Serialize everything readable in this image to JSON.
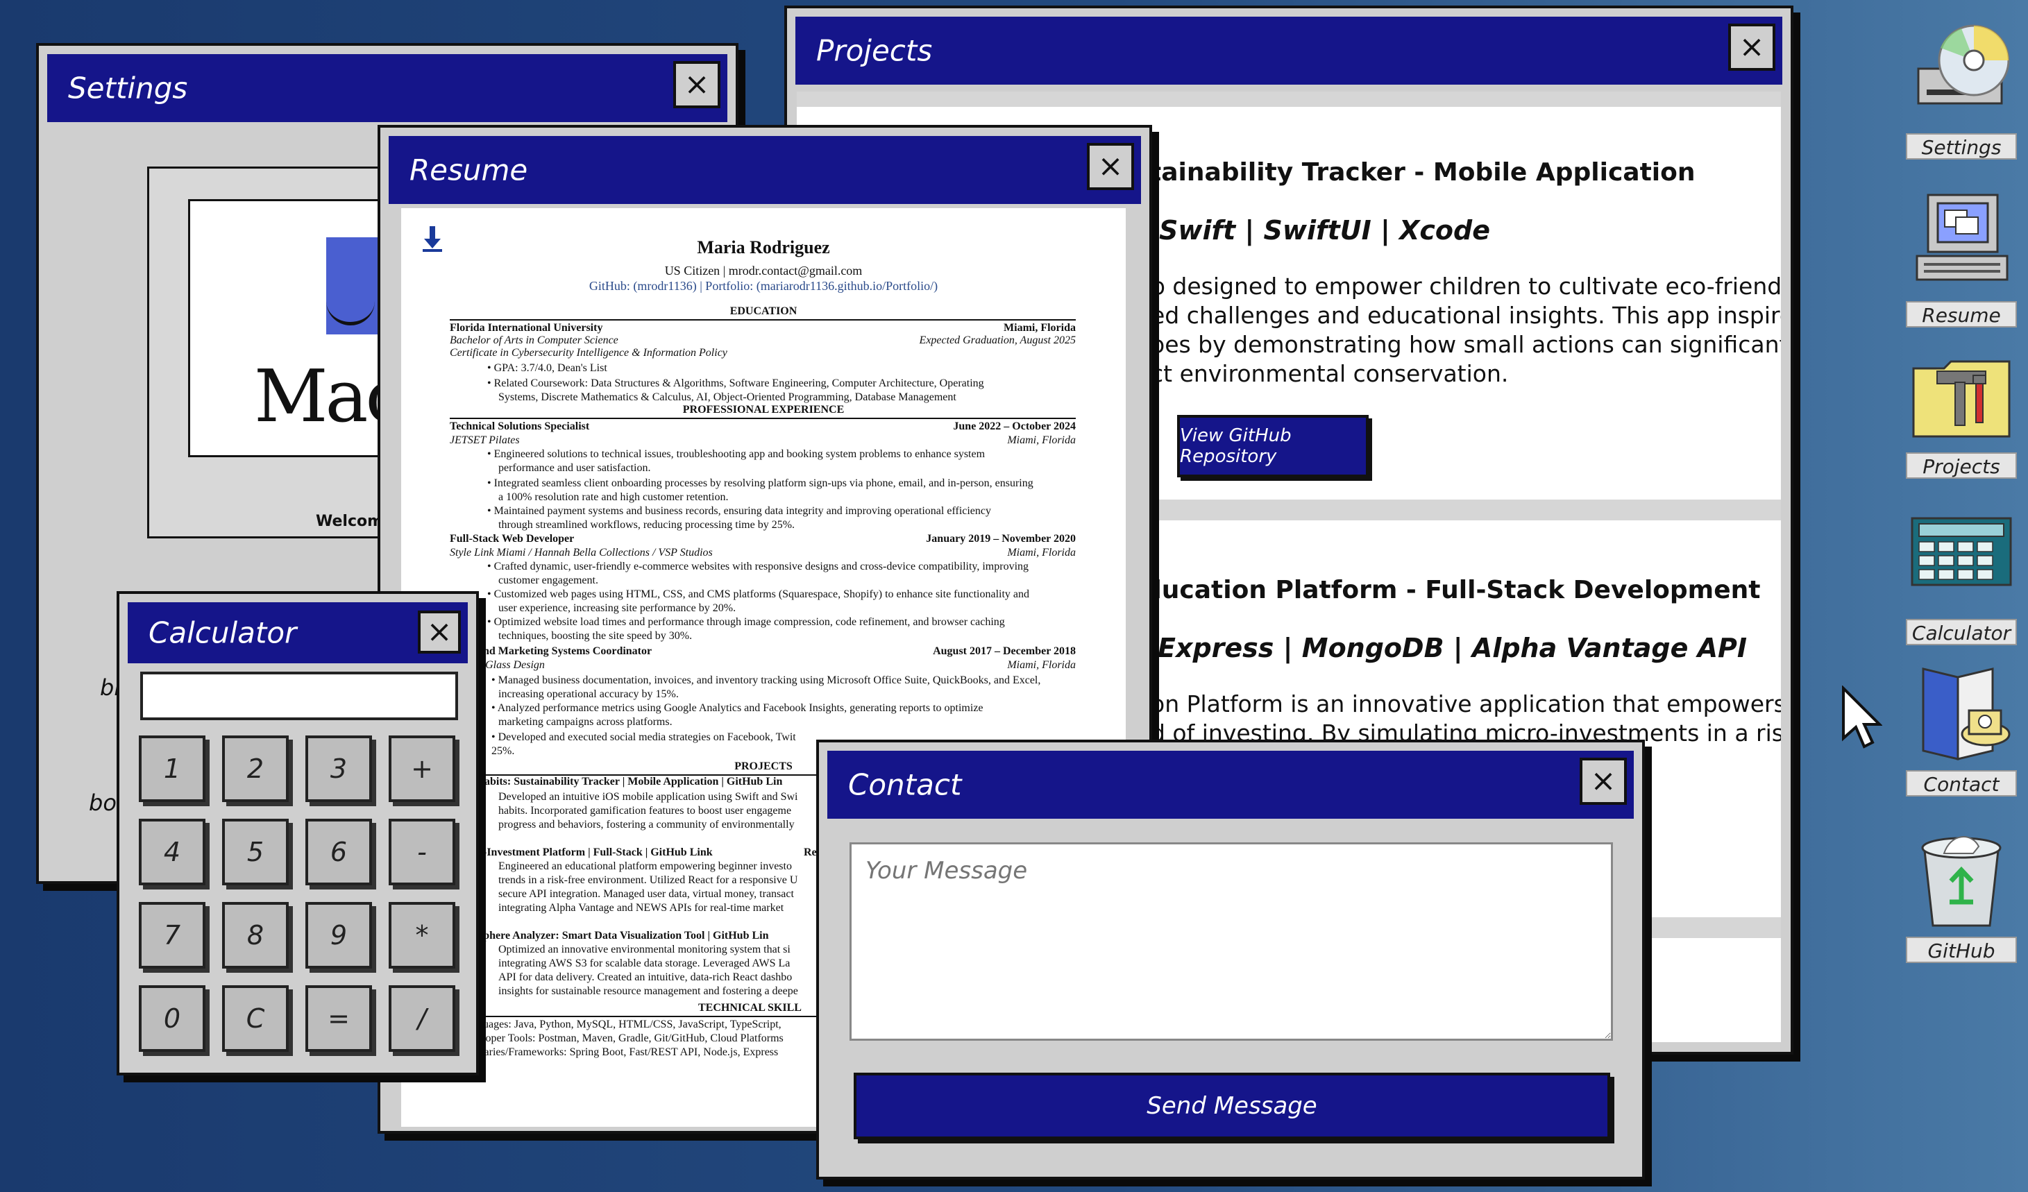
{
  "windows": {
    "settings": {
      "title": "Settings",
      "close": "×",
      "mac_text": "Mac",
      "welcome_text": "Welcom",
      "clipped_text": [
        "bl",
        "bo"
      ]
    },
    "projects": {
      "title": "Projects",
      "close": "×",
      "items": [
        {
          "title": "tainability Tracker - Mobile Application",
          "tech": "Swift | SwiftUI | Xcode",
          "desc": "p designed to empower children to cultivate eco-friendly\ned challenges and educational insights. This app inspires\noes by demonstrating how small actions can significantly\nct environmental conservation.",
          "button": "View GitHub Repository"
        },
        {
          "title": "ducation Platform - Full-Stack Development",
          "tech": "Express | MongoDB | Alpha Vantage API",
          "desc": "on Platform is an innovative application that empowers\nd of investing. By simulating micro-investments in a risk-\ntrategies\nal money."
        }
      ]
    },
    "resume": {
      "title": "Resume",
      "close": "×",
      "name": "Maria Rodriguez",
      "contact_line": "US Citizen | mrodr.contact@gmail.com",
      "links_line": "GitHub: (mrodr1136) | Portfolio: (mariarodr1136.github.io/Portfolio/)",
      "lines": [
        "EDUCATION",
        "Florida International University",
        "Miami, Florida",
        "Bachelor of Arts in Computer Science",
        "Expected Graduation, August 2025",
        "Certificate in Cybersecurity Intelligence & Information Policy",
        "• GPA: 3.7/4.0, Dean's List",
        "• Related Coursework: Data Structures & Algorithms, Software Engineering, Computer Architecture, Operating",
        "Systems, Discrete Mathematics & Calculus, AI, Object-Oriented Programming, Database Management",
        "PROFESSIONAL EXPERIENCE",
        "Technical Solutions Specialist",
        "June 2022 – October 2024",
        "JETSET Pilates",
        "Miami, Florida",
        "• Engineered solutions to technical issues, troubleshooting app and booking system problems to enhance system",
        "performance and user satisfaction.",
        "• Integrated seamless client onboarding processes by resolving platform sign-ups via phone, email, and in-person, ensuring",
        "a 100% resolution rate and high customer retention.",
        "• Maintained payment systems and business records, ensuring data integrity and improving operational efficiency",
        "through streamlined workflows, reducing processing time by 25%.",
        "Full-Stack Web Developer",
        "January 2019 – November 2020",
        "Style Link Miami / Hannah Bella Collections / VSP Studios",
        "Miami, Florida",
        "• Crafted dynamic, user-friendly e-commerce websites with responsive designs and cross-device compatibility, improving",
        "customer engagement.",
        "• Customized web pages using HTML, CSS, and CMS platforms (Squarespace, Shopify) to enhance site functionality and",
        "user experience, increasing site performance by 20%.",
        "• Optimized website load times and performance through image compression, code refinement, and browser caching",
        "techniques, boosting the site speed by 30%.",
        "and Marketing Systems Coordinator",
        "August 2017 – December 2018",
        "y Glass Design",
        "Miami, Florida",
        "• Managed business documentation, invoices, and inventory tracking using Microsoft Office Suite, QuickBooks, and Excel,",
        "increasing operational accuracy by 15%.",
        "• Analyzed performance metrics using Google Analytics and Facebook Insights, generating reports to optimize",
        "marketing campaigns across platforms.",
        "• Developed and executed social media strategies on Facebook, Twit",
        "25%.",
        "PROJECTS",
        "abits: Sustainability Tracker | Mobile Application | GitHub Lin",
        "Developed an intuitive iOS mobile application using Swift and Swi",
        "habits. Incorporated gamification features to boost user engageme",
        "progress and behaviors, fostering a community of environmentally",
        "o-Investment Platform | Full-Stack | GitHub Link",
        "React |",
        "Engineered an educational platform empowering beginner investo",
        "trends in a risk-free environment. Utilized React for a responsive U",
        "secure API integration. Managed user data, virtual money, transact",
        "integrating Alpha Vantage and NEWS APIs for real-time market",
        "sphere Analyzer: Smart Data Visualization Tool | GitHub Lin",
        "Optimized an innovative environmental monitoring system that si",
        "integrating AWS S3 for scalable data storage. Leveraged AWS La",
        "API for data delivery. Created an intuitive, data-rich React dashbo",
        "insights for sustainable resource management and fostering a deepe",
        "TECHNICAL SKILL",
        "guages: Java, Python, MySQL, HTML/CSS, JavaScript, TypeScript,",
        "eloper Tools: Postman, Maven, Gradle, Git/GitHub, Cloud Platforms",
        "Libraries/Frameworks: Spring Boot, Fast/REST API, Node.js, Express"
      ]
    },
    "calculator": {
      "title": "Calculator",
      "close": "×",
      "display": "",
      "keys": [
        "1",
        "2",
        "3",
        "+",
        "4",
        "5",
        "6",
        "-",
        "7",
        "8",
        "9",
        "*",
        "0",
        "C",
        "=",
        "/"
      ]
    },
    "contact": {
      "title": "Contact",
      "close": "×",
      "message_placeholder": "Your Message",
      "send_label": "Send Message"
    }
  },
  "desktop_icons": [
    {
      "label": "Settings",
      "icon": "cd-drive-icon"
    },
    {
      "label": "Resume",
      "icon": "computer-icon"
    },
    {
      "label": "Projects",
      "icon": "folder-tools-icon"
    },
    {
      "label": "Calculator",
      "icon": "calculator-icon"
    },
    {
      "label": "Contact",
      "icon": "phone-book-icon"
    },
    {
      "label": "GitHub",
      "icon": "recycle-bin-icon"
    }
  ],
  "colors": {
    "titlebar": "#15158a",
    "window": "#cfcfcf",
    "desktop": "#234a7f"
  }
}
